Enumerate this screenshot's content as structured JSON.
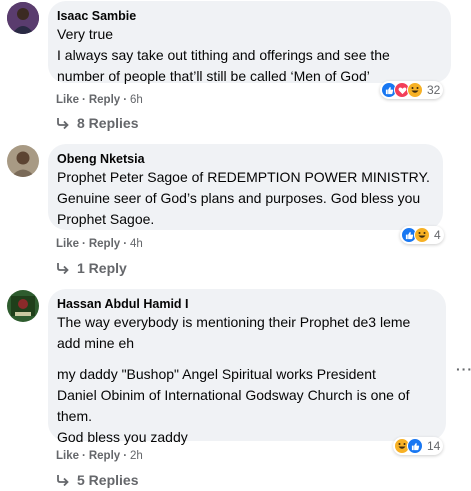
{
  "comments": [
    {
      "author": "Isaac Sambie",
      "lines": [
        "Very true",
        "I always say take out tithing and offerings and see the",
        "number of people that’ll still be called ‘Men of God’"
      ],
      "like": "Like",
      "reply": "Reply",
      "time": "6h",
      "reaction_count": "32",
      "reactions": [
        "like-icon",
        "love-icon",
        "haha-icon"
      ],
      "replies": "8 Replies"
    },
    {
      "author": "Obeng Nketsia",
      "lines": [
        "Prophet Peter Sagoe of REDEMPTION POWER MINISTRY.",
        "Genuine seer of God’s plans and purposes. God bless you",
        "Prophet Sagoe."
      ],
      "like": "Like",
      "reply": "Reply",
      "time": "4h",
      "reaction_count": "4",
      "reactions": [
        "like-icon",
        "haha-icon"
      ],
      "replies": "1 Reply"
    },
    {
      "author": "Hassan Abdul Hamid I",
      "para1": [
        "The way everybody is mentioning their Prophet de3 leme",
        "add mine eh"
      ],
      "para2": [
        "my daddy \"Bushop\" Angel Spiritual works President",
        "Daniel Obinim of International Godsway Church is one of",
        "them.",
        "God bless you zaddy"
      ],
      "like": "Like",
      "reply": "Reply",
      "time": "2h",
      "reaction_count": "14",
      "reactions": [
        "haha-icon",
        "like-icon"
      ],
      "replies": "5 Replies"
    }
  ],
  "more_options": "···",
  "colors": {
    "like_blue": "#1877f2",
    "love_red": "#f33e58",
    "haha_yellow": "#f7b125",
    "bubble": "#f0f2f5",
    "meta": "#65676b"
  }
}
